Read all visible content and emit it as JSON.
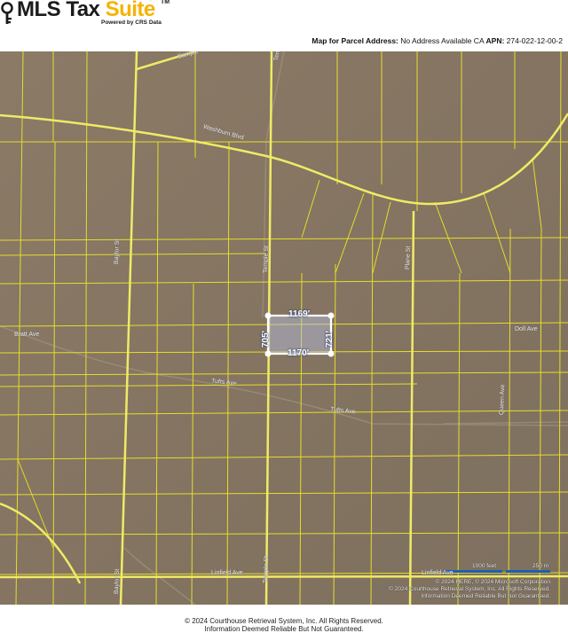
{
  "brand": {
    "name_part1": "MLS Tax ",
    "name_part2": "Suite",
    "tm": "TM",
    "powered_by": "Powered by CRS Data",
    "icon": "key-icon",
    "accent_color": "#f5b300"
  },
  "map_header": {
    "label": "Map for Parcel Address:",
    "address": "No Address Available CA",
    "apn_label": "APN:",
    "apn": "274-022-12-00-2"
  },
  "streets": {
    "temple_top": "Temple St",
    "temple_mid": "Temple St",
    "temple_bottom": "Temple St",
    "baylor_mid": "Baylor St",
    "baylor_bottom": "Baylor St",
    "washburn": "Washburn Blvd",
    "bratt": "Bratt Ave",
    "tufts_1": "Tufts Ave",
    "tufts_2": "Tufts Ave",
    "plane": "Plane St",
    "queen": "Queen Ave",
    "doll": "Doll Ave",
    "linfield_1": "Linfield Ave",
    "linfield_2": "Linfield Ave",
    "sample_top": "Sample"
  },
  "parcel": {
    "top": "1169'",
    "bottom": "1170'",
    "left": "705'",
    "right": "721'",
    "highlight_color": "#b7c4e6"
  },
  "scale": {
    "feet": "1000 feet",
    "meters": "250 m"
  },
  "attribution": {
    "line1": "© 2024 HERE, © 2024 Microsoft Corporation",
    "line2": "© 2024 Courthouse Retrieval System, Inc. All Rights Reserved.",
    "line3": "Information Deemed Reliable But Not Guaranteed."
  },
  "footer": {
    "line1": "© 2024 Courthouse Retrieval System, Inc. All Rights Reserved.",
    "line2": "Information Deemed Reliable But Not Guaranteed."
  },
  "colors": {
    "parcel_lines": "#e6dd2a",
    "terrain": "#857663"
  }
}
